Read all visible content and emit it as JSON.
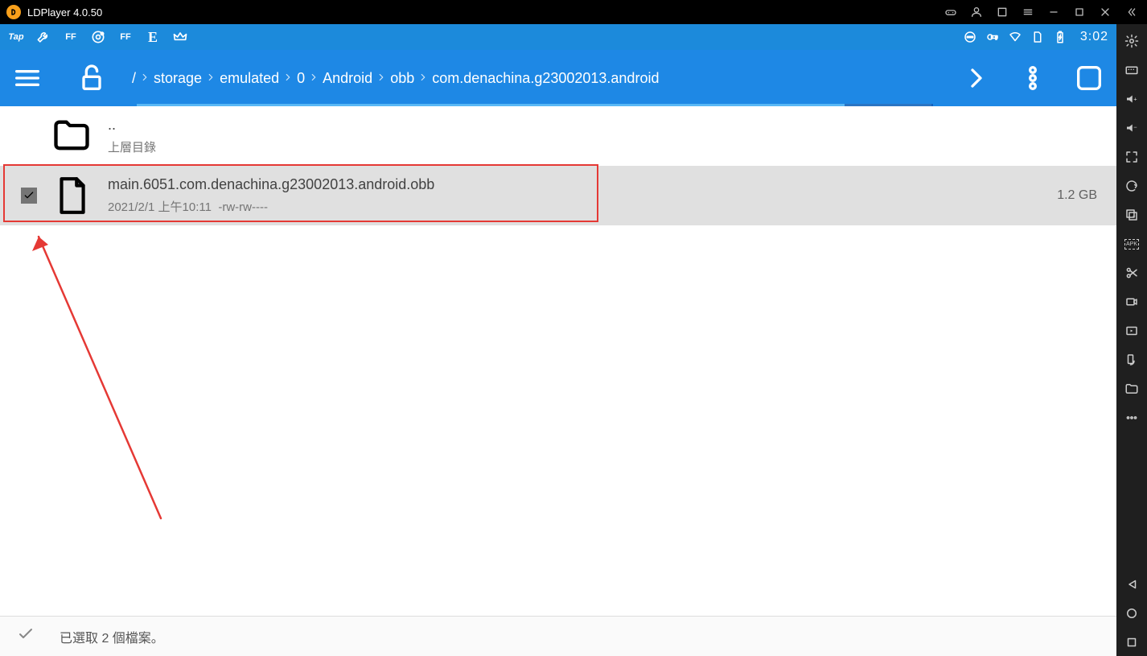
{
  "window": {
    "title": "LDPlayer 4.0.50"
  },
  "statusbar": {
    "clock": "3:02"
  },
  "breadcrumb": {
    "root": "/",
    "items": [
      "storage",
      "emulated",
      "0",
      "Android",
      "obb",
      "com.denachina.g23002013.android"
    ]
  },
  "files": {
    "parent": {
      "name": "..",
      "meta": "上層目錄"
    },
    "items": [
      {
        "name": "main.6051.com.denachina.g23002013.android.obb",
        "date": "2021/2/1 上午10:11",
        "perms": "-rw-rw----",
        "size": "1.2 GB",
        "selected": true
      }
    ]
  },
  "bottombar": {
    "status": "已選取 2 個檔案。"
  }
}
